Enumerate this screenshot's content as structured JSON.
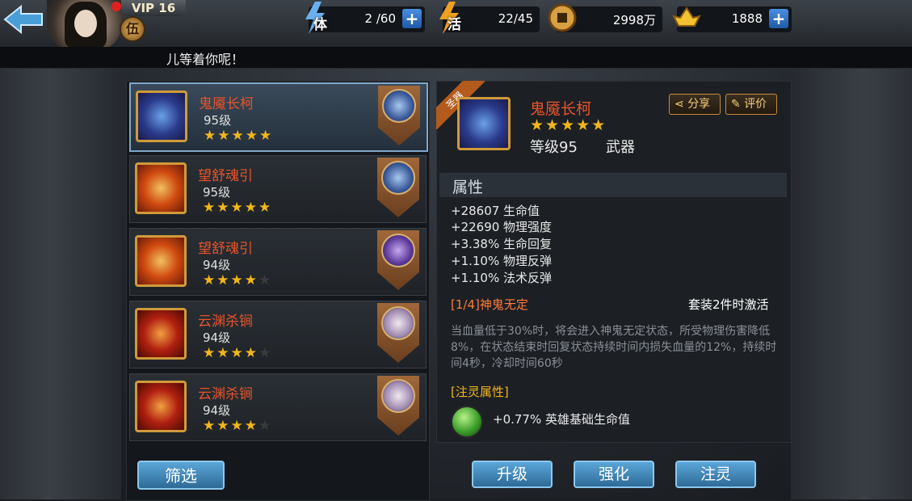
{
  "header": {
    "vip": "VIP 16",
    "rank": "伍",
    "resources": [
      {
        "icon": "stamina-icon",
        "label": "体",
        "value": "2 /60",
        "has_plus": true
      },
      {
        "icon": "energy-icon",
        "label": "活",
        "value": "22/45",
        "has_plus": false
      },
      {
        "icon": "coin-icon",
        "label": "",
        "value": "2998万",
        "has_plus": false
      },
      {
        "icon": "gold-ingot-icon",
        "label": "",
        "value": "1888",
        "has_plus": true
      }
    ],
    "marquee": "儿等着你呢！"
  },
  "equipment_list": [
    {
      "name": "鬼魇长柯",
      "level": "95级",
      "stars": 5,
      "thumb": "blue",
      "selected": true
    },
    {
      "name": "望舒魂引",
      "level": "95级",
      "stars": 5,
      "thumb": "orange",
      "selected": false
    },
    {
      "name": "望舒魂引",
      "level": "94级",
      "stars": 4,
      "thumb": "orange",
      "selected": false
    },
    {
      "name": "云渊杀锏",
      "level": "94级",
      "stars": 4,
      "thumb": "red",
      "selected": false
    },
    {
      "name": "云渊杀锏",
      "level": "94级",
      "stars": 4,
      "thumb": "red",
      "selected": false
    }
  ],
  "filter_label": "筛选",
  "detail": {
    "tag": "圣器",
    "name": "鬼魇长柯",
    "stars": "★★★★★",
    "level": "等级95",
    "type": "武器",
    "share": "分享",
    "review": "评价",
    "attr_title": "属性",
    "stats": [
      "+28607 生命值",
      "+22690 物理强度",
      "+3.38% 生命回复",
      "+1.10% 物理反弹",
      "+1.10% 法术反弹"
    ],
    "set_title": "[1/4]神鬼无定",
    "set_active": "套装2件时激活",
    "set_desc": "当血量低于30%时，将会进入神鬼无定状态，所受物理伤害降低8%，在状态结束时回复状态持续时间内损失血量的12%，持续时间4秒，冷却时间60秒",
    "spirit_title": "[注灵属性]",
    "spirit_value": "+0.77% 英雄基础生命值"
  },
  "actions": {
    "upgrade": "升级",
    "enhance": "强化",
    "infuse": "注灵"
  }
}
